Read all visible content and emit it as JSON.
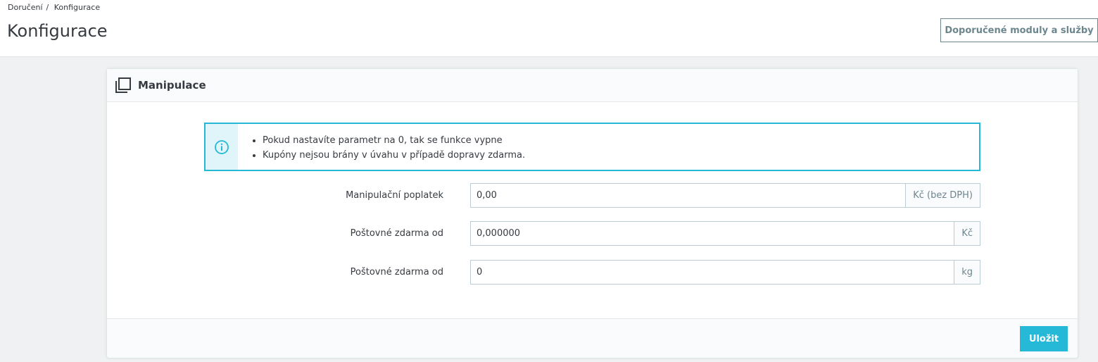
{
  "breadcrumb": {
    "items": [
      "Doručení",
      "Konfigurace"
    ],
    "separator": "/"
  },
  "header": {
    "title": "Konfigurace",
    "recommended_button": "Doporučené moduly a služby"
  },
  "panel": {
    "title": "Manipulace",
    "icon": "copy-window-icon",
    "alert": {
      "icon": "info-circle-icon",
      "items": [
        "Pokud nastavíte parametr na 0, tak se funkce vypne",
        "Kupóny nejsou brány v úvahu v případě dopravy zdarma."
      ]
    },
    "fields": [
      {
        "label": "Manipulační poplatek",
        "value": "0,00",
        "suffix": "Kč (bez DPH)"
      },
      {
        "label": "Poštovné zdarma od",
        "value": "0,000000",
        "suffix": "Kč"
      },
      {
        "label": "Poštovné zdarma od",
        "value": "0",
        "suffix": "kg"
      }
    ],
    "save_label": "Uložit"
  },
  "colors": {
    "accent": "#25b9d7",
    "alert_bg": "#e0f5fa",
    "page_bg": "#eff1f2",
    "muted": "#6c868e"
  }
}
